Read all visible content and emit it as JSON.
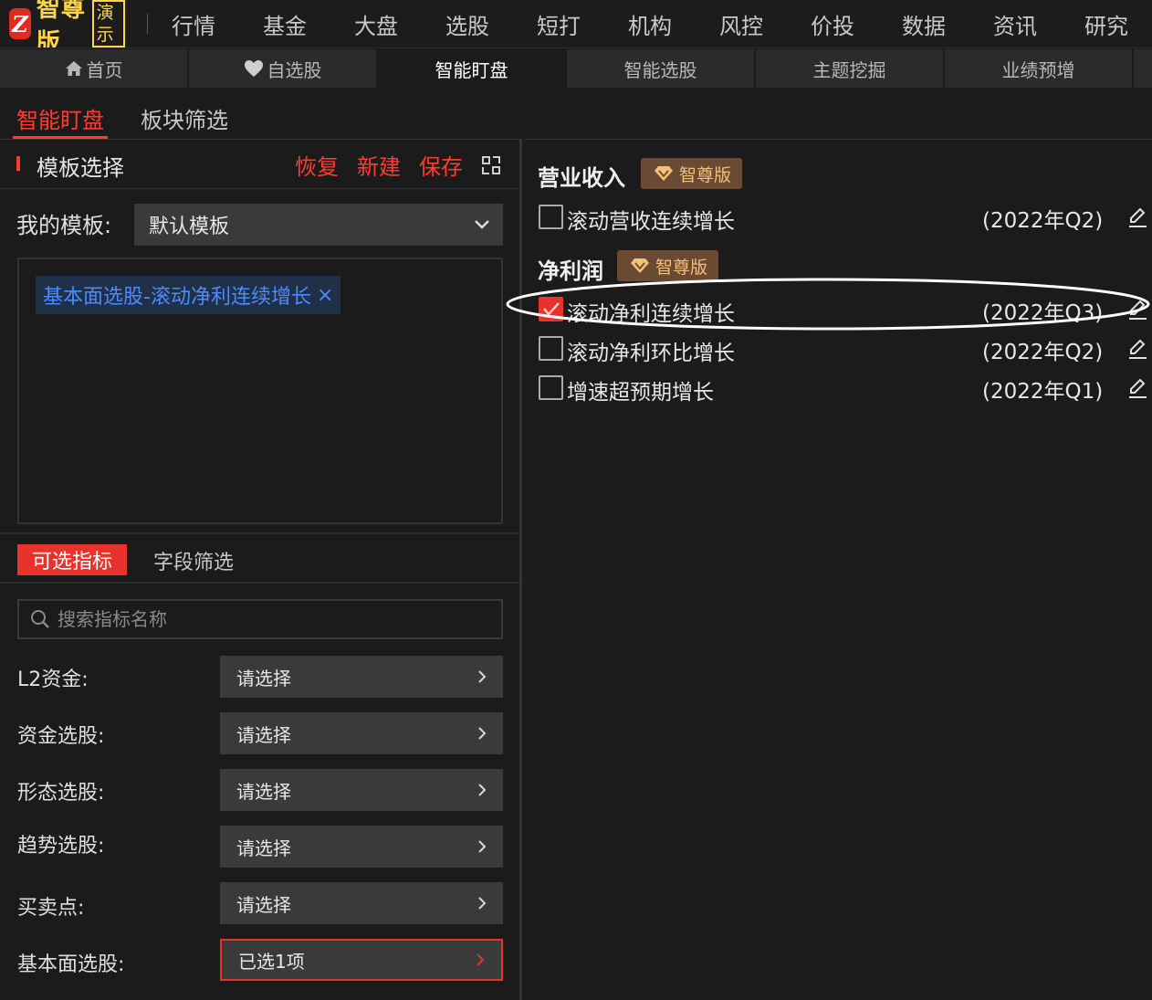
{
  "logo": {
    "mark": "Z",
    "text": "智尊版",
    "demo": "演示"
  },
  "nav": [
    "行情",
    "基金",
    "大盘",
    "选股",
    "短打",
    "机构",
    "风控",
    "价投",
    "数据",
    "资讯",
    "研究"
  ],
  "subtabs": [
    {
      "label": "首页",
      "icon": "home-icon"
    },
    {
      "label": "自选股",
      "icon": "heart-icon"
    },
    {
      "label": "智能盯盘",
      "active": true
    },
    {
      "label": "智能选股"
    },
    {
      "label": "主题挖掘"
    },
    {
      "label": "业绩预增"
    }
  ],
  "page_tabs": [
    {
      "label": "智能盯盘",
      "active": true
    },
    {
      "label": "板块筛选"
    }
  ],
  "template": {
    "title": "模板选择",
    "restore": "恢复",
    "create": "新建",
    "save": "保存",
    "my_label": "我的模板:",
    "my_value": "默认模板",
    "tag": "基本面选股-滚动净利连续增长",
    "tag_close": "×"
  },
  "indicator_tabs": {
    "active": "可选指标",
    "other": "字段筛选"
  },
  "search": {
    "placeholder": "搜索指标名称"
  },
  "filters": [
    {
      "label": "L2资金:",
      "value": "请选择"
    },
    {
      "label": "资金选股:",
      "value": "请选择"
    },
    {
      "label": "形态选股:",
      "value": "请选择"
    },
    {
      "label": "趋势选股:",
      "value": "请选择"
    },
    {
      "label": "买卖点:",
      "value": "请选择"
    },
    {
      "label": "基本面选股:",
      "value": "已选1项",
      "selected": true
    }
  ],
  "right": {
    "sections": [
      {
        "title": "营业收入",
        "badge": "智尊版",
        "items": [
          {
            "label": "滚动营收连续增长",
            "period": "(2022年Q2)",
            "checked": false
          }
        ]
      },
      {
        "title": "净利润",
        "badge": "智尊版",
        "items": [
          {
            "label": "滚动净利连续增长",
            "period": "(2022年Q3)",
            "checked": true
          },
          {
            "label": "滚动净利环比增长",
            "period": "(2022年Q2)",
            "checked": false
          },
          {
            "label": "增速超预期增长",
            "period": "(2022年Q1)",
            "checked": false
          }
        ]
      }
    ]
  },
  "colors": {
    "accent": "#e8332c",
    "gold": "#ffd44a",
    "badge_bg": "#6b4a33",
    "badge_fg": "#f3c079",
    "tag_fg": "#4a8cff"
  }
}
